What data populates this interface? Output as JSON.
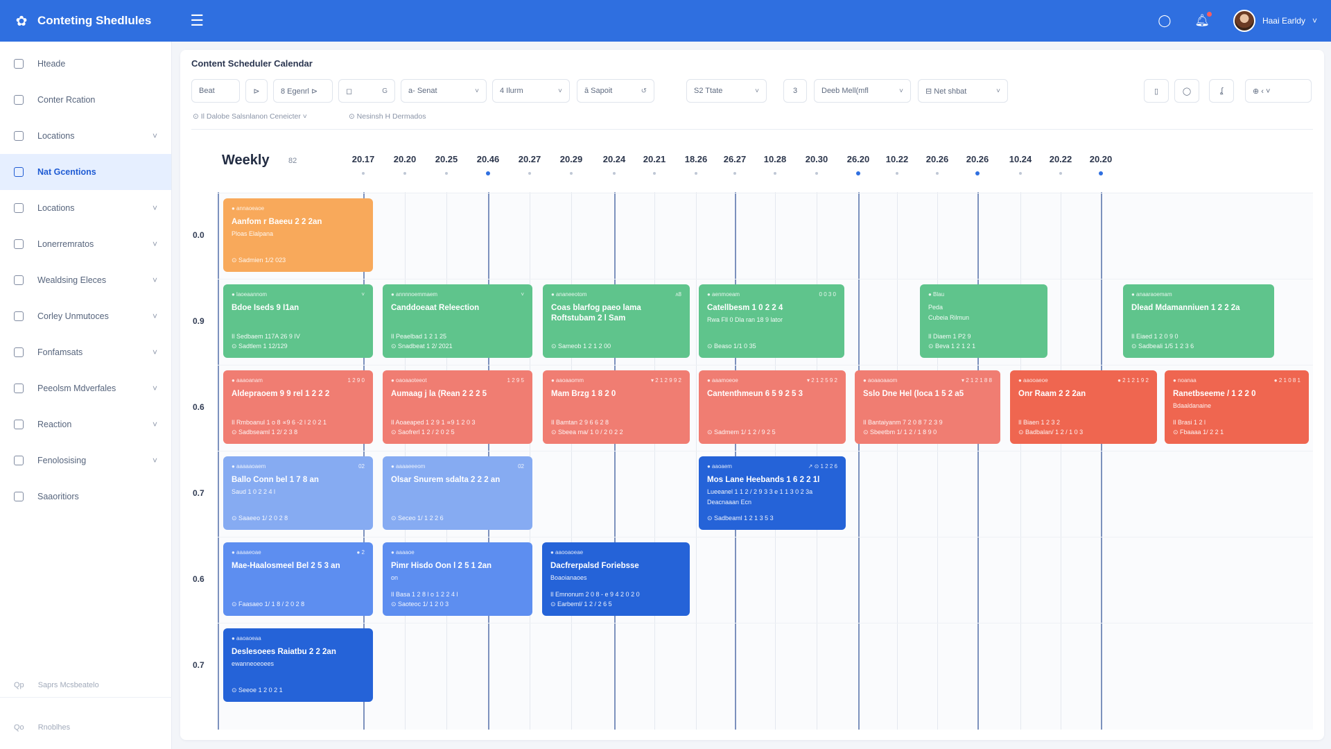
{
  "topbar": {
    "title": "Conteting Shedlules",
    "user_name": "Haai Earldy",
    "colors": {
      "brand": "#2f6fe0"
    }
  },
  "sidebar": {
    "items": [
      {
        "label": "Hteade",
        "has_chevron": false
      },
      {
        "label": "Conter Rcation",
        "has_chevron": false
      },
      {
        "label": "Locations",
        "has_chevron": true
      },
      {
        "label": "Nat Gcentions",
        "has_chevron": false,
        "active": true
      },
      {
        "label": "Locations",
        "has_chevron": true
      },
      {
        "label": "Lonerremratos",
        "has_chevron": true
      },
      {
        "label": "Wealdsing Eleces",
        "has_chevron": true
      },
      {
        "label": "Corley Unmutoces",
        "has_chevron": true
      },
      {
        "label": "Fonfamsats",
        "has_chevron": true
      },
      {
        "label": "Peeolsm Mdverfales",
        "has_chevron": true
      },
      {
        "label": "Reaction",
        "has_chevron": true
      },
      {
        "label": "Fenolosising",
        "has_chevron": true
      },
      {
        "label": "Saaoritiors",
        "has_chevron": false
      }
    ],
    "footer_1": "Saprs Mcsbeatelo",
    "footer_2": "Rnoblhes",
    "footer_1_icon": "Qp",
    "footer_2_icon": "Qo"
  },
  "main": {
    "title": "Content Scheduler Calendar",
    "filters": [
      {
        "label": "Beat"
      },
      {
        "label": "⊳"
      },
      {
        "label": "8 Egenrl ⊳"
      },
      {
        "label": "◻",
        "extra": "G"
      },
      {
        "label": "a- Senat"
      },
      {
        "label": "4  Ilurm"
      },
      {
        "label": "ā  Sapoit",
        "extra": "↺"
      },
      {
        "label": "S2 Ttate"
      },
      {
        "label": "3"
      },
      {
        "label": "Deeb  Mell(mfl"
      },
      {
        "label": "⊟  Net shbat"
      }
    ],
    "right_tools": [
      "▯",
      "◯",
      "ʆ",
      "⊕  ‹ ˅"
    ],
    "sub_1": "⊙   Il Dalobe Salsnlanon Ceneicter  ˅",
    "sub_2": "⊙   Nesinsh H Dermados",
    "weekly": "Weekly",
    "week_number": "82",
    "dates": [
      "20.17",
      "20.20",
      "20.25",
      "20.46",
      "20.27",
      "20.29",
      "20.24",
      "20.21",
      "18.26",
      "26.27",
      "10.28",
      "20.30",
      "26.20",
      "10.22",
      "20.26",
      "20.26",
      "10.24",
      "20.22",
      "20.20"
    ],
    "rows": [
      "0.0",
      "0.9",
      "0.6",
      "0.7",
      "0.6",
      "0.7"
    ]
  },
  "cards": [
    {
      "color": "orange",
      "tag": "● annaoeaoe",
      "tag_r": "",
      "title": "Aanfom r Baeeu 2 2 2an",
      "sub": "Ploas Elalpana",
      "meta1": "",
      "meta2": "⊙ Sadmien 1/2 023"
    },
    {
      "color": "green",
      "tag": "● laoeaannom",
      "tag_r": "˅",
      "title": "Bdoe Iseds 9 I1an",
      "sub": "",
      "meta1": "Il Sedbaem 117A 26 9 IV",
      "meta2": "⊙ Sadtlem 1 12/129"
    },
    {
      "color": "green",
      "tag": "● annnnoemmaem",
      "tag_r": "˅",
      "title": "Canddoeaat Releection",
      "sub": "",
      "meta1": "Il Peaelbad 1 2 1 25",
      "meta2": "⊙ Snadbeat 1 2/ 2021"
    },
    {
      "color": "green",
      "tag": "● ananeeotom",
      "tag_r": "ʌ8",
      "title": "Coas blarfog paeo lama Roftstubam 2 l Sam",
      "sub": "",
      "meta1": "",
      "meta2": "⊙ Sameob 1 2 1 2 00"
    },
    {
      "color": "green",
      "tag": "● aenmoeam",
      "tag_r": "0 0 3 0",
      "title": "Catellbesm 1 0 2 2 4",
      "sub": "Rwa Fll 0 Dla ran 18 9 lator",
      "meta1": "",
      "meta2": "⊙ Beaso 1/1 0 35"
    },
    {
      "color": "green",
      "tag": "● Blau",
      "tag_r": "",
      "title": "",
      "sub": "Peda",
      "meta1": "Il Diaem 1 P2 9",
      "meta2": "⊙ Beva 1 2 1 2 1",
      "sub2": "Cubeia Rilmun"
    },
    {
      "color": "green",
      "tag": "● anaaraoemam",
      "tag_r": "",
      "title": "Dlead Mdamanniuen 1 2 2 2a",
      "sub": "",
      "meta1": "Il Eiaed 1 2 0 9 0",
      "meta2": "⊙ Sadbeali 1/5 1 2 3 6"
    },
    {
      "color": "coral",
      "tag": "● aaaoanam",
      "tag_r": "1 2 9 0",
      "title": "Aldepraoem 9 9 rel 1 2 2 2",
      "sub": "",
      "meta1": "Il Rmboanul 1 o 8 ∝9 6 -2 l 2 0 2 1",
      "meta2": "⊙ Sadbseaml 1 2/ 2 3 8"
    },
    {
      "color": "coral",
      "tag": "● oaoaaoteeot",
      "tag_r": "1 2 9 5",
      "title": "Aumaag j la (Rean 2 2 2 5",
      "sub": "",
      "meta1": "Il Aoaeaped 1 2 9 1 ∝9 1 2 0 3",
      "meta2": "⊙ Saofrerl 1 2 / 2 0 2 5"
    },
    {
      "color": "coral",
      "tag": "● aaoaaomm",
      "tag_r": "▾ 2 1 2 9 9 2",
      "title": "Mam Brzg 1 8 2 0",
      "sub": "",
      "meta1": "Il Bamtan 2 9 6 6 2 8",
      "meta2": "⊙ Sbeea ma/ 1 0 / 2 0 2 2"
    },
    {
      "color": "coral",
      "tag": "● aaamoeoe",
      "tag_r": "▾ 2 1 2 5 9 2",
      "title": "Cantenthmeun 6 5 9 2 5 3",
      "sub": "",
      "meta1": "",
      "meta2": "⊙ Sadmem 1/ 1 2 / 9 2 5"
    },
    {
      "color": "coral",
      "tag": "● aoaaoaaom",
      "tag_r": "▾ 2 1 2 1 8 8",
      "title": "Sslo Dne Hel (loca 1 5 2 a5",
      "sub": "",
      "meta1": "Il Bantaiyanm 7 2 0 8 7 2 3 9",
      "meta2": "⊙ Sbeetbm 1/ 1 2 / 1 8 9 0"
    },
    {
      "color": "red",
      "tag": "● aaooaeoe",
      "tag_r": "● 2 1 2 1 9 2",
      "title": "Onr Raam 2 2 2an",
      "sub": "",
      "meta1": "Il Biaen 1 2 3 2",
      "meta2": "⊙ Badbalan/ 1 2 / 1 0 3"
    },
    {
      "color": "red",
      "tag": "● noanaa",
      "tag_r": "● 2 1 0 8 1",
      "title": "Ranetbseeme / 1 2 2 0",
      "sub": "Bdaaldanaine",
      "meta1": "Il Brasi 1 2 l",
      "meta2": "⊙ Fbaaaa 1/ 2 2 1"
    },
    {
      "color": "lblue",
      "tag": "● aaaaaoaem",
      "tag_r": "02",
      "title": "Ballo Conn bel 1 7 8 an",
      "sub": "Saud 1 0 2 2 4 l",
      "meta1": "",
      "meta2": "⊙ Saaeeo 1/ 2 0 2 8"
    },
    {
      "color": "lblue",
      "tag": "● aaaaeeeom",
      "tag_r": "02",
      "title": "Olsar Snurem sdalta 2 2 2 an",
      "sub": "",
      "meta1": "",
      "meta2": "⊙ Seceo 1/ 1 2 2 6"
    },
    {
      "color": "dblue",
      "tag": "● aaoaem",
      "tag_r": "↗ ⊙ 1 2 2 6",
      "title": "Mos Lane Heebands 1 6 2 2 1l",
      "sub": "Lueeanel 1 1 2 / 2 9 3 3  e 1 1 3 0 2 3a",
      "sub2": "Deacnaaan Ecn",
      "meta1": "",
      "meta2": "⊙ Sadbeaml 1 2 1 3 5 3"
    },
    {
      "color": "mblue",
      "tag": "● aaaaeoae",
      "tag_r": "● 2",
      "title": "Mae-Haalosmeel Bel 2 5 3 an",
      "sub": "",
      "meta1": "",
      "meta2": "⊙ Faasaeo 1/ 1 8 / 2 0 2 8"
    },
    {
      "color": "mblue",
      "tag": "● aaaaoe",
      "tag_r": "",
      "title": "Pimr Hisdo Oon l 2 5 1 2an",
      "sub": "on",
      "meta1": "Il Basa 1 2 8 l o 1 2 2 4 l",
      "meta2": "⊙ Saoteoc 1/ 1 2 0 3"
    },
    {
      "color": "dblue",
      "tag": "● aaooaoeae",
      "tag_r": "",
      "title": "Dacfrerpalsd Foriebsse",
      "sub": "Boaoianaoes",
      "meta1": "Il Emnonum 2 0 8 - e 9 4 2 0 2 0",
      "meta2": "⊙ Earbeml/ 1 2 / 2 6 5"
    },
    {
      "color": "dblue",
      "tag": "● aaoaoeaa",
      "tag_r": "",
      "title": "Deslesoees Raiatbu 2 2 2an",
      "sub": "ewanneoeoees",
      "meta1": "",
      "meta2": "⊙ Seeoe 1 2 0 2 1"
    }
  ]
}
